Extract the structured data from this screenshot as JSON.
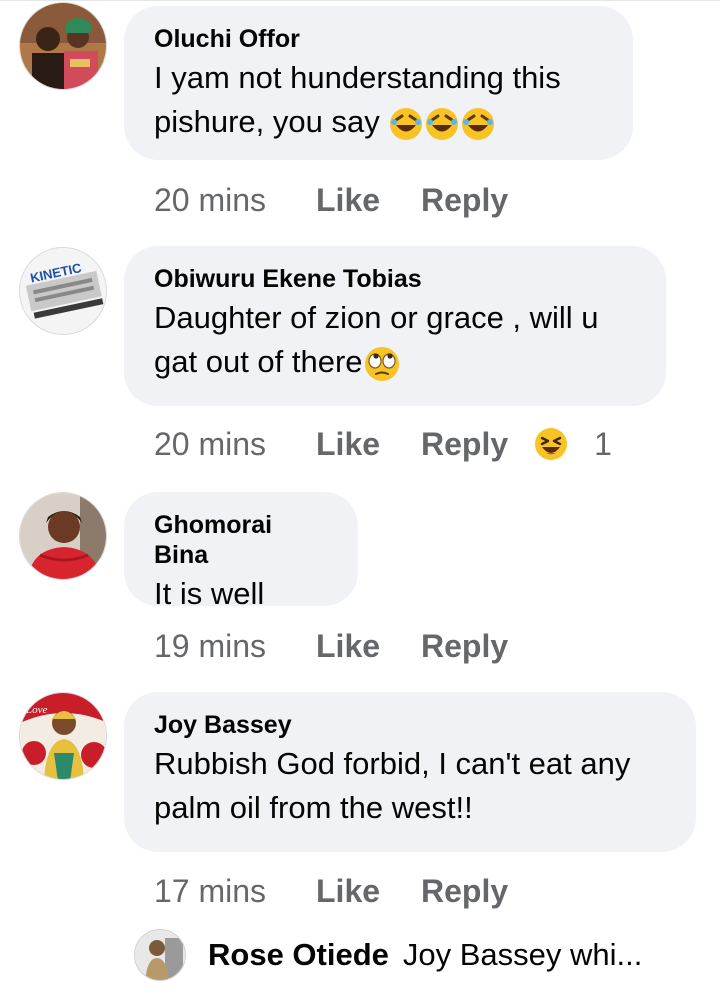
{
  "comments": [
    {
      "author": "Oluchi Offor",
      "text_lines": [
        "I yam not hunderstanding this",
        "pishure, you say"
      ],
      "emoji_count": 3,
      "time": "20 mins",
      "like": "Like",
      "reply": "Reply"
    },
    {
      "author": "Obiwuru Ekene Tobias",
      "text_lines": [
        "Daughter of zion or grace , will u",
        "gat out of there"
      ],
      "time": "20 mins",
      "like": "Like",
      "reply": "Reply",
      "avatar_logo_text": "KINETIC",
      "reaction_count": "1"
    },
    {
      "author": "Ghomorai Bina",
      "text_lines": [
        "It is well"
      ],
      "time": "19 mins",
      "like": "Like",
      "reply": "Reply"
    },
    {
      "author": "Joy Bassey",
      "text_lines": [
        "Rubbish God forbid, I can't eat any",
        "palm oil from the west!!"
      ],
      "time": "17 mins",
      "like": "Like",
      "reply": "Reply",
      "avatar_overlay_text": "Love"
    }
  ],
  "reply_preview": {
    "author": "Rose Otiede",
    "text": "Joy Bassey whi..."
  },
  "colors": {
    "bubble": "#f0f2f5",
    "meta": "#65676b",
    "emoji": "#f7c325"
  }
}
